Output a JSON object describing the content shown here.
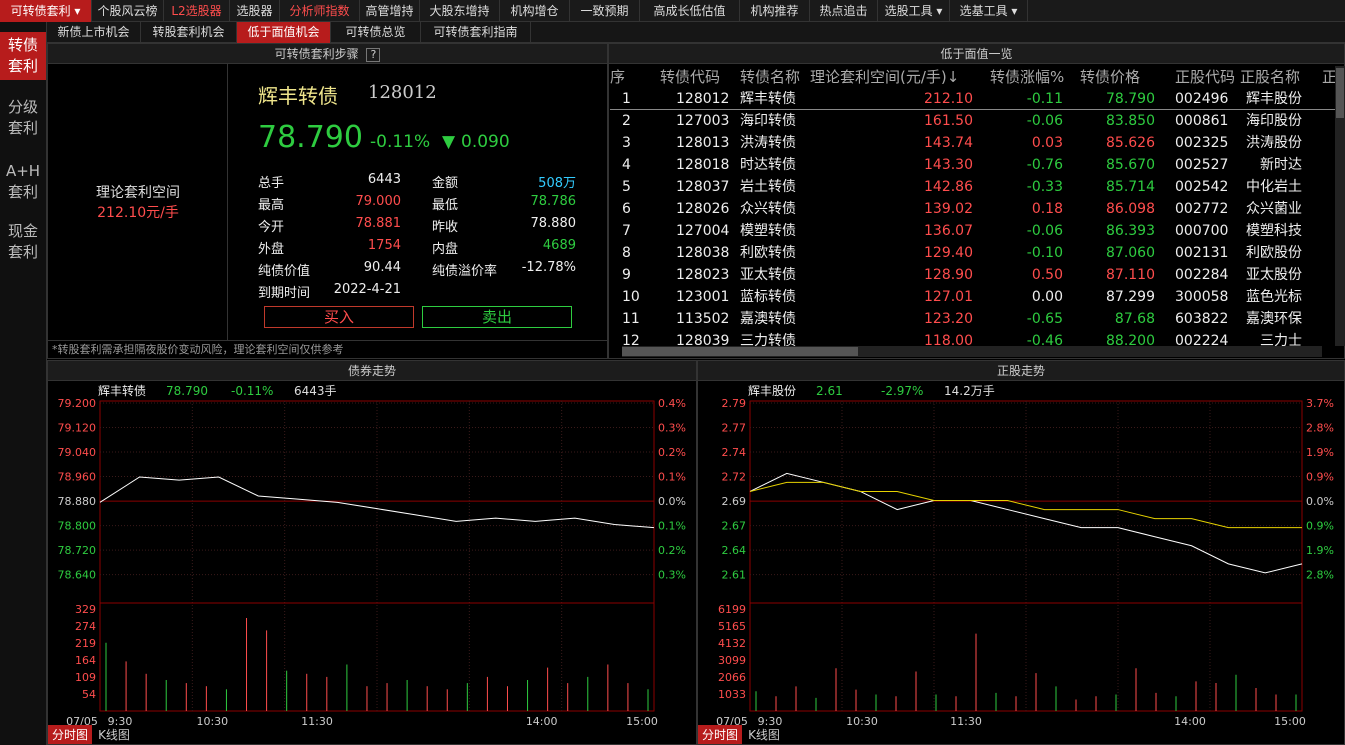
{
  "topnav": [
    {
      "label": "可转债套利 ▾",
      "style": "active"
    },
    {
      "label": "个股风云榜",
      "style": ""
    },
    {
      "label": "L2选股器",
      "style": "red"
    },
    {
      "label": "选股器",
      "style": ""
    },
    {
      "label": "分析师指数",
      "style": "red"
    },
    {
      "label": "高管增持",
      "style": ""
    },
    {
      "label": "大股东增持",
      "style": ""
    },
    {
      "label": "机构增仓",
      "style": ""
    },
    {
      "label": "一致预期",
      "style": ""
    },
    {
      "label": "高成长低估值",
      "style": ""
    },
    {
      "label": "机构推荐",
      "style": ""
    },
    {
      "label": "热点追击",
      "style": ""
    },
    {
      "label": "选股工具 ▾",
      "style": ""
    },
    {
      "label": "选基工具 ▾",
      "style": ""
    }
  ],
  "sidebar": [
    "转债\n套利",
    "分级\n套利",
    "A+H\n套利",
    "现金\n套利"
  ],
  "subtabs": [
    "新债上市机会",
    "转股套利机会",
    "低于面值机会",
    "可转债总览",
    "可转债套利指南"
  ],
  "left_panel": {
    "header": "可转债套利步骤",
    "help_icon": "?",
    "space_label": "理论套利空间",
    "space_value": "212.10元/手",
    "name": "辉丰转债",
    "code": "128012",
    "price": "78.790",
    "change_pct": "-0.11%",
    "change_arrow": "▼",
    "change": "0.090",
    "rows": [
      {
        "k1": "总手",
        "v1": "6443",
        "c1": "white",
        "k2": "金额",
        "v2": "508万",
        "c2": "cyan"
      },
      {
        "k1": "最高",
        "v1": "79.000",
        "c1": "red",
        "k2": "最低",
        "v2": "78.786",
        "c2": "green"
      },
      {
        "k1": "今开",
        "v1": "78.881",
        "c1": "red",
        "k2": "昨收",
        "v2": "78.880",
        "c2": "white"
      },
      {
        "k1": "外盘",
        "v1": "1754",
        "c1": "red",
        "k2": "内盘",
        "v2": "4689",
        "c2": "green"
      },
      {
        "k1": "纯债价值",
        "v1": "90.44",
        "c1": "white",
        "k2": "纯债溢价率",
        "v2": "-12.78%",
        "c2": "white"
      },
      {
        "k1": "到期时间",
        "v1": "2022-4-21",
        "c1": "white",
        "k2": "",
        "v2": "",
        "c2": "white"
      }
    ],
    "buy": "买入",
    "sell": "卖出",
    "note": "*转股套利需承担隔夜股价变动风险，理论套利空间仅供参考"
  },
  "table": {
    "header": "低于面值一览",
    "columns": [
      "序",
      "转债代码",
      "转债名称",
      "理论套利空间(元/手)↓",
      "转债涨幅%",
      "转债价格",
      "正股代码",
      "正股名称",
      "正"
    ],
    "rows": [
      [
        "1",
        "128012",
        "辉丰转债",
        "212.10",
        "-0.11",
        "78.790",
        "002496",
        "辉丰股份"
      ],
      [
        "2",
        "127003",
        "海印转债",
        "161.50",
        "-0.06",
        "83.850",
        "000861",
        "海印股份"
      ],
      [
        "3",
        "128013",
        "洪涛转债",
        "143.74",
        "0.03",
        "85.626",
        "002325",
        "洪涛股份"
      ],
      [
        "4",
        "128018",
        "时达转债",
        "143.30",
        "-0.76",
        "85.670",
        "002527",
        "新时达"
      ],
      [
        "5",
        "128037",
        "岩土转债",
        "142.86",
        "-0.33",
        "85.714",
        "002542",
        "中化岩土"
      ],
      [
        "6",
        "128026",
        "众兴转债",
        "139.02",
        "0.18",
        "86.098",
        "002772",
        "众兴菌业"
      ],
      [
        "7",
        "127004",
        "模塑转债",
        "136.07",
        "-0.06",
        "86.393",
        "000700",
        "模塑科技"
      ],
      [
        "8",
        "128038",
        "利欧转债",
        "129.40",
        "-0.10",
        "87.060",
        "002131",
        "利欧股份"
      ],
      [
        "9",
        "128023",
        "亚太转债",
        "128.90",
        "0.50",
        "87.110",
        "002284",
        "亚太股份"
      ],
      [
        "10",
        "123001",
        "蓝标转债",
        "127.01",
        "0.00",
        "87.299",
        "300058",
        "蓝色光标"
      ],
      [
        "11",
        "113502",
        "嘉澳转债",
        "123.20",
        "-0.65",
        "87.68",
        "603822",
        "嘉澳环保"
      ],
      [
        "12",
        "128039",
        "三力转债",
        "118.00",
        "-0.46",
        "88.200",
        "002224",
        "三力士"
      ]
    ]
  },
  "chart_data": [
    {
      "type": "line",
      "title": "债券走势",
      "legend": {
        "name": "辉丰转债",
        "price": "78.790",
        "pct": "-0.11%",
        "vol": "6443手"
      },
      "y_left": [
        "79.200",
        "79.120",
        "79.040",
        "78.960",
        "78.880",
        "78.800",
        "78.720",
        "78.640"
      ],
      "y_right": [
        "0.4%",
        "0.3%",
        "0.2%",
        "0.1%",
        "0.0%",
        "0.1%",
        "0.2%",
        "0.3%"
      ],
      "ylim": [
        78.6,
        79.2
      ],
      "vol_ticks": [
        "329",
        "274",
        "219",
        "164",
        "109",
        "54"
      ],
      "vol_max": 329,
      "x_ticks": [
        "07/05",
        "9:30",
        "10:30",
        "11:30",
        "14:00",
        "15:00"
      ],
      "price": [
        78.88,
        78.96,
        78.95,
        78.96,
        78.9,
        78.89,
        78.88,
        78.86,
        78.84,
        78.82,
        78.83,
        78.82,
        78.83,
        78.81,
        78.8
      ],
      "volume": [
        220,
        160,
        120,
        100,
        90,
        80,
        70,
        300,
        260,
        130,
        120,
        110,
        150,
        80,
        90,
        100,
        80,
        70,
        90,
        110,
        80,
        100,
        140,
        90,
        110,
        150,
        90,
        70
      ]
    },
    {
      "type": "line",
      "title": "正股走势",
      "legend": {
        "name": "辉丰股份",
        "price": "2.61",
        "pct": "-2.97%",
        "vol": "14.2万手"
      },
      "y_left": [
        "2.79",
        "2.77",
        "2.74",
        "2.72",
        "2.69",
        "2.67",
        "2.64",
        "2.61"
      ],
      "y_right": [
        "3.7%",
        "2.8%",
        "1.9%",
        "0.9%",
        "0.0%",
        "0.9%",
        "1.9%",
        "2.8%"
      ],
      "ylim": [
        2.58,
        2.79
      ],
      "vol_ticks": [
        "6199",
        "5165",
        "4132",
        "3099",
        "2066",
        "1033"
      ],
      "vol_max": 6199,
      "x_ticks": [
        "07/05",
        "9:30",
        "10:30",
        "11:30",
        "14:00",
        "15:00"
      ],
      "price": [
        2.69,
        2.71,
        2.7,
        2.69,
        2.67,
        2.68,
        2.68,
        2.67,
        2.66,
        2.65,
        2.65,
        2.64,
        2.63,
        2.61,
        2.6,
        2.61
      ],
      "avg": [
        2.69,
        2.7,
        2.7,
        2.69,
        2.69,
        2.68,
        2.68,
        2.68,
        2.67,
        2.67,
        2.67,
        2.66,
        2.66,
        2.65,
        2.65,
        2.65
      ],
      "volume": [
        1200,
        900,
        1500,
        800,
        2600,
        1300,
        1000,
        900,
        2400,
        1000,
        900,
        4700,
        1100,
        900,
        2300,
        1500,
        700,
        900,
        1000,
        2600,
        1100,
        900,
        1800,
        1700,
        2200,
        1400,
        1000,
        1000
      ]
    }
  ],
  "chart_tabs": [
    "分时图",
    "K线图"
  ]
}
